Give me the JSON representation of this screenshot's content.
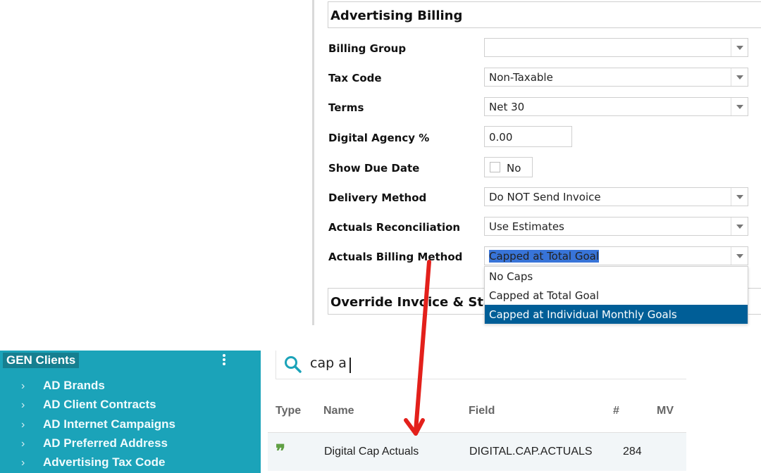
{
  "form": {
    "section_title": "Advertising Billing",
    "fields": {
      "billing_group": {
        "label": "Billing Group",
        "value": ""
      },
      "tax_code": {
        "label": "Tax Code",
        "value": "Non-Taxable"
      },
      "terms": {
        "label": "Terms",
        "value": "Net 30"
      },
      "digital_agency": {
        "label": "Digital Agency %",
        "value": "0.00"
      },
      "show_due_date": {
        "label": "Show Due Date",
        "value": "No"
      },
      "delivery_method": {
        "label": "Delivery Method",
        "value": "Do NOT Send Invoice"
      },
      "actuals_reconciliation": {
        "label": "Actuals Reconciliation",
        "value": "Use Estimates"
      },
      "actuals_billing_method": {
        "label": "Actuals Billing Method",
        "value": "Capped at Total Goal"
      }
    },
    "dropdown_options": [
      "No Caps",
      "Capped at Total Goal",
      "Capped at Individual Monthly Goals"
    ],
    "next_section_title": "Override Invoice & Statem"
  },
  "sidebar": {
    "title": "GEN Clients",
    "items": [
      "AD Brands",
      "AD Client Contracts",
      "AD Internet Campaigns",
      "AD Preferred Address",
      "Advertising Tax Code"
    ]
  },
  "search": {
    "query": "cap a",
    "columns": {
      "type": "Type",
      "name": "Name",
      "field": "Field",
      "num": "#",
      "mv": "MV"
    },
    "result": {
      "name": "Digital Cap Actuals",
      "field": "DIGITAL.CAP.ACTUALS",
      "num": "284"
    }
  },
  "colors": {
    "sidebar_bg": "#1ba3b9",
    "highlight_option": "#005e97",
    "selected_text": "#3874d8",
    "annotation_arrow": "#e3201b"
  }
}
